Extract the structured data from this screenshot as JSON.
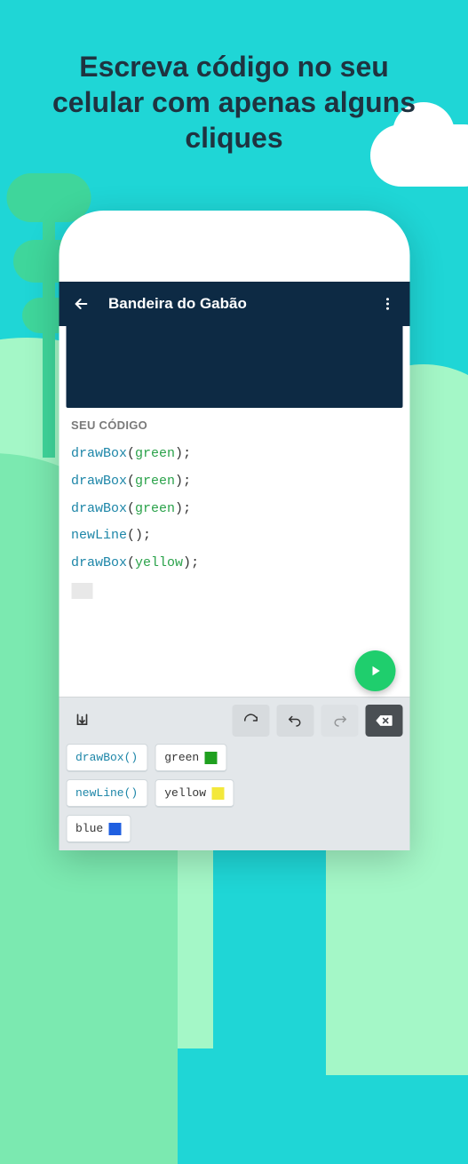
{
  "headline": "Escreva código no seu celular com apenas alguns cliques",
  "appbar": {
    "title": "Bandeira do Gabão"
  },
  "code": {
    "label": "SEU CÓDIGO",
    "lines": [
      {
        "fn": "drawBox",
        "arg": "green"
      },
      {
        "fn": "drawBox",
        "arg": "green"
      },
      {
        "fn": "drawBox",
        "arg": "green"
      },
      {
        "fn": "newLine",
        "arg": ""
      },
      {
        "fn": "drawBox",
        "arg": "yellow"
      }
    ]
  },
  "tokens": {
    "col1": [
      {
        "type": "fn",
        "label": "drawBox()"
      },
      {
        "type": "fn",
        "label": "newLine()"
      },
      {
        "type": "color",
        "label": "blue",
        "swatch": "sw-blue"
      }
    ],
    "col2": [
      {
        "type": "color",
        "label": "green",
        "swatch": "sw-green"
      },
      {
        "type": "color",
        "label": "yellow",
        "swatch": "sw-yellow"
      }
    ]
  }
}
